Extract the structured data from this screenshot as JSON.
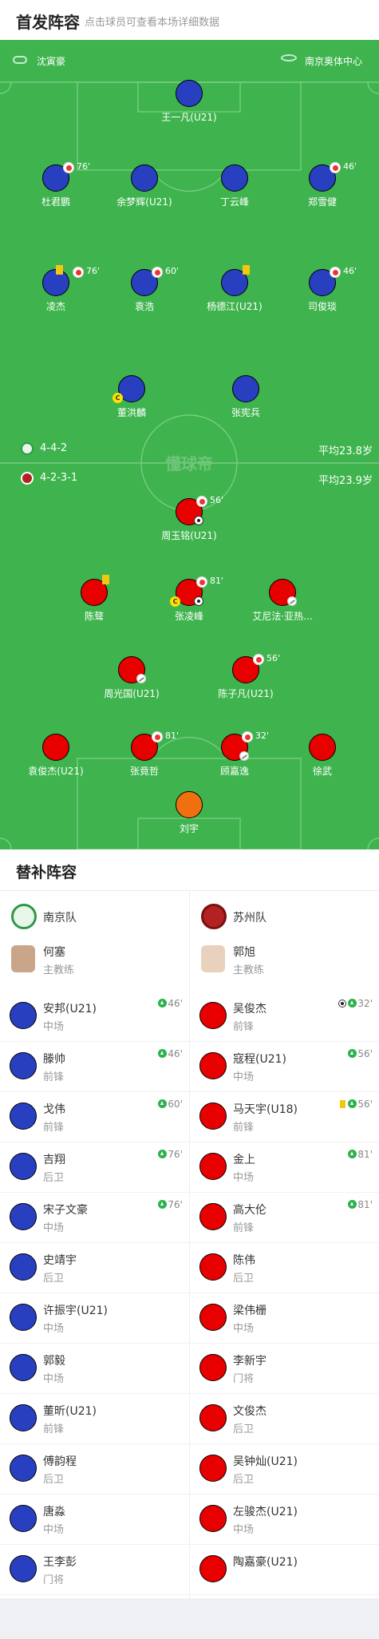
{
  "header": {
    "title": "首发阵容",
    "subtitle": "点击球员可查看本场详细数据"
  },
  "match": {
    "coach_left": "沈寅豪",
    "venue": "南京奥体中心",
    "home_formation": "4-4-2",
    "home_avg_age": "平均23.8岁",
    "away_formation": "4-2-3-1",
    "away_avg_age": "平均23.9岁",
    "watermark": "懂球帝"
  },
  "colors": {
    "home_shirt": "#2840c0",
    "away_shirt": "#e80000",
    "away_gk": "#f07010",
    "pitch": "#3fb44e"
  },
  "home_lineup": [
    {
      "name": "王一凡(U21)",
      "sub": "",
      "yellow": false,
      "captain": false
    },
    {
      "name": "杜君鹏",
      "sub": "76'",
      "yellow": false,
      "captain": false
    },
    {
      "name": "余梦辉(U21)",
      "sub": "",
      "yellow": false,
      "captain": false
    },
    {
      "name": "丁云峰",
      "sub": "",
      "yellow": false,
      "captain": false
    },
    {
      "name": "郑雪健",
      "sub": "46'",
      "yellow": false,
      "captain": false
    },
    {
      "name": "凌杰",
      "sub": "76'",
      "yellow": true,
      "captain": false
    },
    {
      "name": "袁浩",
      "sub": "60'",
      "yellow": false,
      "captain": false
    },
    {
      "name": "杨德江(U21)",
      "sub": "",
      "yellow": true,
      "captain": false
    },
    {
      "name": "司俊琰",
      "sub": "46'",
      "yellow": false,
      "captain": false
    },
    {
      "name": "董洪麟",
      "sub": "",
      "yellow": false,
      "captain": true
    },
    {
      "name": "张宪兵",
      "sub": "",
      "yellow": false,
      "captain": false
    }
  ],
  "away_lineup": [
    {
      "name": "周玉铭(U21)",
      "sub": "56'",
      "goal": true
    },
    {
      "name": "陈骜",
      "sub": "",
      "yellow": true
    },
    {
      "name": "张凌峰",
      "sub": "81'",
      "captain": true,
      "goal": true
    },
    {
      "name": "艾尼法·亚热...",
      "sub": "",
      "assist": true
    },
    {
      "name": "周光国(U21)",
      "sub": "",
      "assist": true
    },
    {
      "name": "陈子凡(U21)",
      "sub": "56'"
    },
    {
      "name": "袁俊杰(U21)",
      "sub": ""
    },
    {
      "name": "张竟哲",
      "sub": "81'"
    },
    {
      "name": "顾嘉逸",
      "sub": "32'",
      "assist": true
    },
    {
      "name": "徐武",
      "sub": ""
    },
    {
      "name": "刘宇",
      "sub": ""
    }
  ],
  "subs_header": {
    "title": "替补阵容"
  },
  "home_subs": {
    "team": "南京队",
    "coach": {
      "name": "何塞",
      "role": "主教练"
    },
    "players": [
      {
        "name": "安邦(U21)",
        "pos": "中场",
        "event": "46'"
      },
      {
        "name": "滕帅",
        "pos": "前锋",
        "event": "46'"
      },
      {
        "name": "戈伟",
        "pos": "前锋",
        "event": "60'"
      },
      {
        "name": "吉翔",
        "pos": "后卫",
        "event": "76'"
      },
      {
        "name": "宋子文豪",
        "pos": "中场",
        "event": "76'"
      },
      {
        "name": "史靖宇",
        "pos": "后卫",
        "event": ""
      },
      {
        "name": "许振宇(U21)",
        "pos": "中场",
        "event": ""
      },
      {
        "name": "郭毅",
        "pos": "中场",
        "event": ""
      },
      {
        "name": "董昕(U21)",
        "pos": "前锋",
        "event": ""
      },
      {
        "name": "傅韵程",
        "pos": "后卫",
        "event": ""
      },
      {
        "name": "唐淼",
        "pos": "中场",
        "event": ""
      },
      {
        "name": "王李彭",
        "pos": "门将",
        "event": ""
      }
    ]
  },
  "away_subs": {
    "team": "苏州队",
    "coach": {
      "name": "郭旭",
      "role": "主教练"
    },
    "players": [
      {
        "name": "吴俊杰",
        "pos": "前锋",
        "event": "32'"
      },
      {
        "name": "寇程(U21)",
        "pos": "中场",
        "event": "56'"
      },
      {
        "name": "马天宇(U18)",
        "pos": "前锋",
        "event": "56'"
      },
      {
        "name": "金上",
        "pos": "中场",
        "event": "81'"
      },
      {
        "name": "高大伦",
        "pos": "前锋",
        "event": "81'"
      },
      {
        "name": "陈伟",
        "pos": "后卫",
        "event": ""
      },
      {
        "name": "梁伟栅",
        "pos": "中场",
        "event": ""
      },
      {
        "name": "李新宇",
        "pos": "门将",
        "event": ""
      },
      {
        "name": "文俊杰",
        "pos": "后卫",
        "event": ""
      },
      {
        "name": "吴钟灿(U21)",
        "pos": "后卫",
        "event": ""
      },
      {
        "name": "左骏杰(U21)",
        "pos": "中场",
        "event": ""
      },
      {
        "name": "陶嘉豪(U21)",
        "pos": "",
        "event": ""
      }
    ]
  }
}
